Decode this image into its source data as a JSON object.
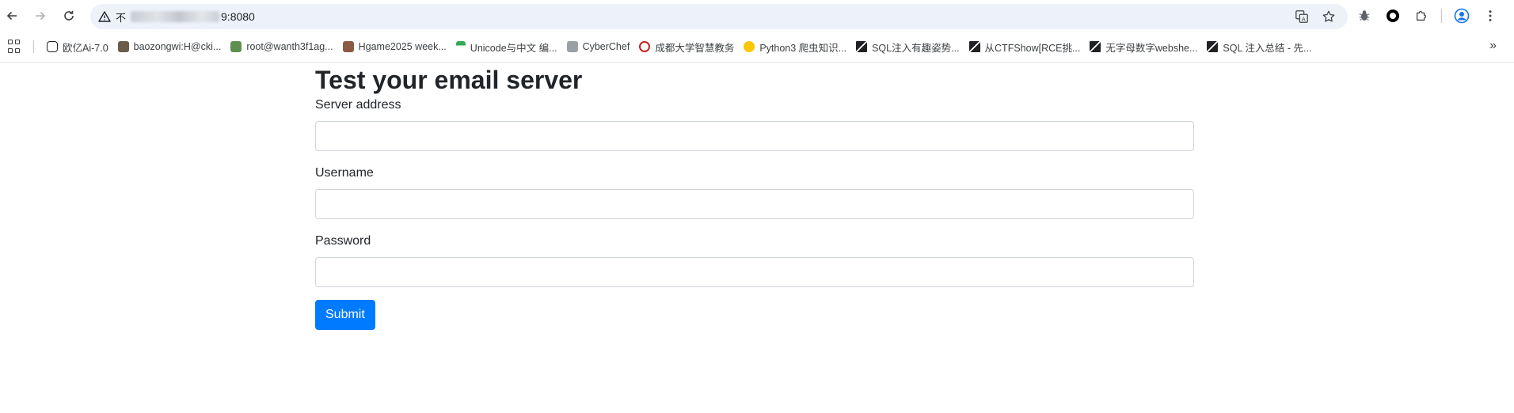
{
  "browser": {
    "address": {
      "insecure_label": "不",
      "port_suffix": "9:8080"
    },
    "bookmarks": [
      {
        "label": "欧亿Ai-7.0",
        "icon": "chat-bubble-icon",
        "color": "#202124"
      },
      {
        "label": "baozongwi:H@cki...",
        "icon": "avatar-photo-icon",
        "color": "#6b5b4b"
      },
      {
        "label": "root@wanth3f1ag...",
        "icon": "plant-icon",
        "color": "#5f8f4e"
      },
      {
        "label": "Hgame2025 week...",
        "icon": "person-icon",
        "color": "#8a5a44"
      },
      {
        "label": "Unicode与中文 编...",
        "icon": "tree-icon",
        "color": "#34a853"
      },
      {
        "label": "CyberChef",
        "icon": "chef-hat-icon",
        "color": "#9aa0a6"
      },
      {
        "label": "成都大学智慧教务",
        "icon": "university-seal-icon",
        "color": "#c5221f"
      },
      {
        "label": "Python3 爬虫知识...",
        "icon": "biohazard-icon",
        "color": "#f9c800"
      },
      {
        "label": "SQL注入有趣姿势...",
        "icon": "zhihu-slash-icon",
        "color": "#202124"
      },
      {
        "label": "从CTFShow[RCE挑...",
        "icon": "zhihu-slash-icon",
        "color": "#202124"
      },
      {
        "label": "无字母数字webshe...",
        "icon": "zhihu-slash-icon",
        "color": "#202124"
      },
      {
        "label": "SQL 注入总结 - 先...",
        "icon": "zhihu-slash-icon",
        "color": "#202124"
      }
    ]
  },
  "form": {
    "title": "Test your email server",
    "fields": [
      {
        "label": "Server address",
        "value": ""
      },
      {
        "label": "Username",
        "value": ""
      },
      {
        "label": "Password",
        "value": ""
      }
    ],
    "submit_label": "Submit",
    "accent_color": "#007bff"
  }
}
